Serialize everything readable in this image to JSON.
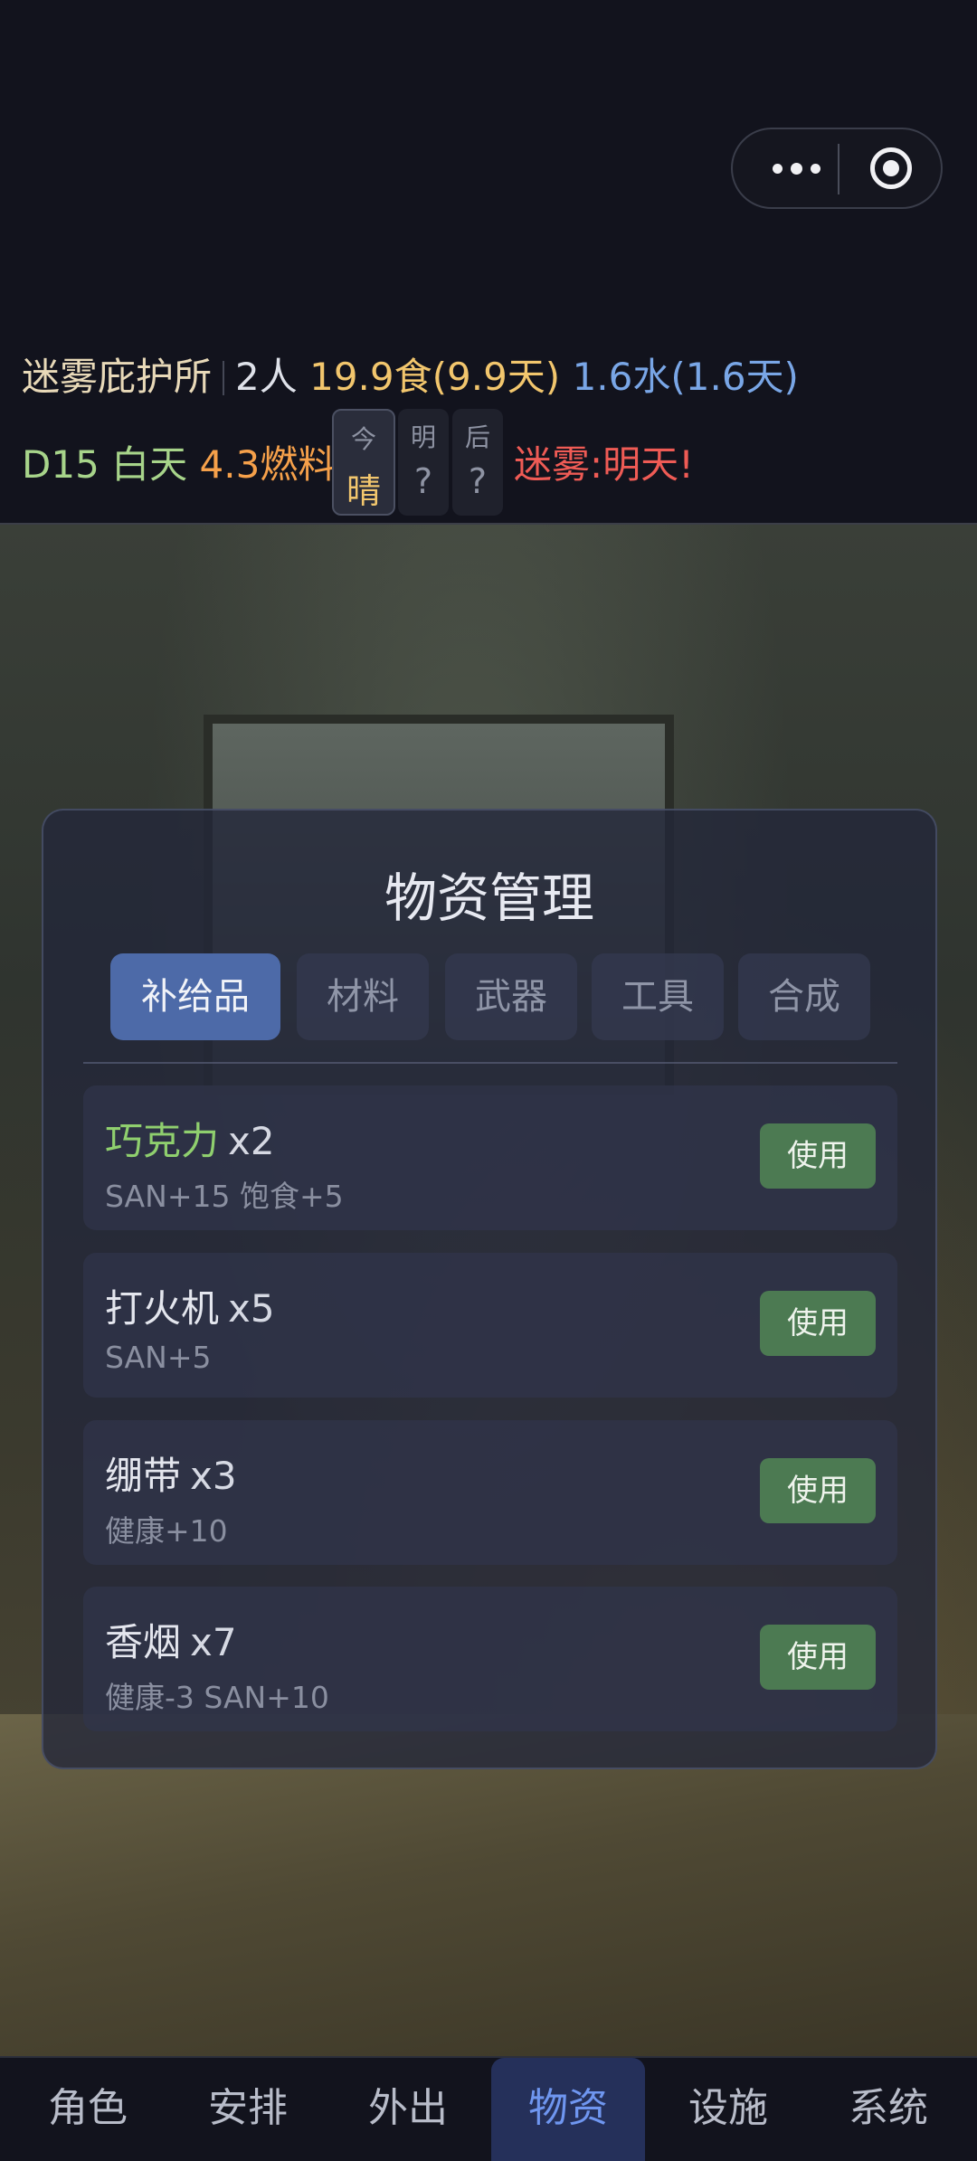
{
  "capsule": {
    "more_icon": "more-dots-icon",
    "close_icon": "target-circle-icon"
  },
  "status": {
    "shelter_name": "迷雾庇护所",
    "people": "2人",
    "food": "19.9食(9.9天)",
    "water": "1.6水(1.6天)",
    "day": "D15",
    "time_of_day": "白天",
    "fuel": "4.3燃料",
    "weather": [
      {
        "day": "今",
        "value": "晴"
      },
      {
        "day": "明",
        "value": "?"
      },
      {
        "day": "后",
        "value": "?"
      }
    ],
    "fog_warning": "迷雾:明天!"
  },
  "panel": {
    "title": "物资管理",
    "tabs": [
      "补给品",
      "材料",
      "武器",
      "工具",
      "合成"
    ],
    "active_tab": "补给品",
    "items": [
      {
        "name": "巧克力",
        "qty": "x2",
        "desc": "SAN+15 饱食+5",
        "button": "使用"
      },
      {
        "name": "打火机",
        "qty": "x5",
        "desc": "SAN+5",
        "button": "使用"
      },
      {
        "name": "绷带",
        "qty": "x3",
        "desc": "健康+10",
        "button": "使用"
      },
      {
        "name": "香烟",
        "qty": "x7",
        "desc": "健康-3 SAN+10",
        "button": "使用"
      }
    ]
  },
  "nav": {
    "items": [
      "角色",
      "安排",
      "外出",
      "物资",
      "设施",
      "系统"
    ],
    "active": "物资"
  }
}
